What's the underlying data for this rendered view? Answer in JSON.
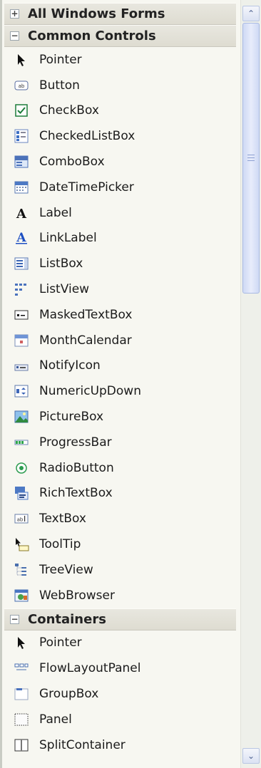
{
  "groups": [
    {
      "label": "All Windows Forms",
      "expander": "+"
    },
    {
      "label": "Common Controls",
      "expander": "−"
    },
    {
      "label": "Containers",
      "expander": "−"
    }
  ],
  "common_controls": [
    "Pointer",
    "Button",
    "CheckBox",
    "CheckedListBox",
    "ComboBox",
    "DateTimePicker",
    "Label",
    "LinkLabel",
    "ListBox",
    "ListView",
    "MaskedTextBox",
    "MonthCalendar",
    "NotifyIcon",
    "NumericUpDown",
    "PictureBox",
    "ProgressBar",
    "RadioButton",
    "RichTextBox",
    "TextBox",
    "ToolTip",
    "TreeView",
    "WebBrowser"
  ],
  "containers": [
    "Pointer",
    "FlowLayoutPanel",
    "GroupBox",
    "Panel",
    "SplitContainer"
  ],
  "scrollbar": {
    "up_glyph": "⌃",
    "down_glyph": "⌄"
  }
}
